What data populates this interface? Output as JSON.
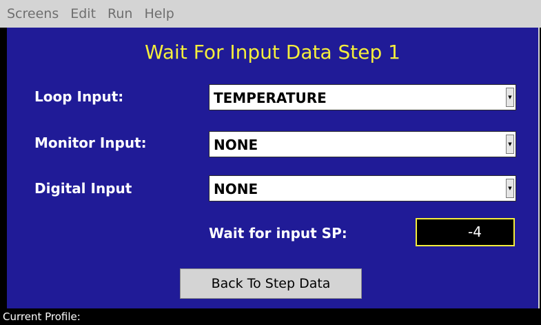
{
  "menubar": {
    "items": [
      "Screens",
      "Edit",
      "Run",
      "Help"
    ]
  },
  "screen": {
    "title": "Wait For Input Data Step 1",
    "loop_input": {
      "label": "Loop Input:",
      "value": "TEMPERATURE"
    },
    "monitor_input": {
      "label": "Monitor Input:",
      "value": "NONE"
    },
    "digital_input": {
      "label": "Digital Input",
      "value": "NONE"
    },
    "wait_sp": {
      "label": "Wait for input SP:",
      "value": "-4"
    },
    "back_button": "Back To Step Data"
  },
  "status": {
    "text": "Current Profile:"
  },
  "colors": {
    "background": "#201b97",
    "title": "#f5ef3c",
    "menubar": "#d4d4d4"
  },
  "icons": {
    "dropdown_arrow": "triangle-down"
  }
}
